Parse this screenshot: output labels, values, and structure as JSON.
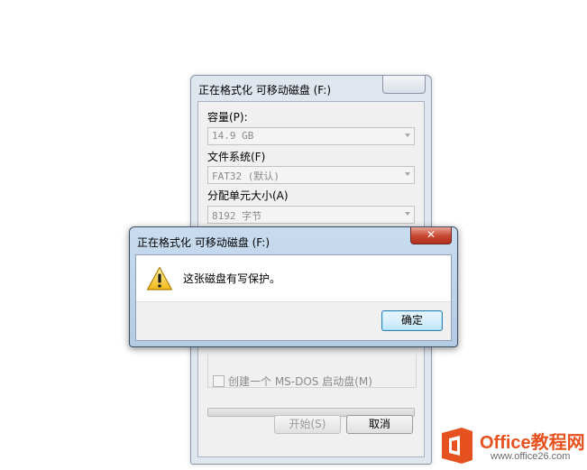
{
  "format_window": {
    "title": "正在格式化 可移动磁盘 (F:)",
    "capacity_label": "容量(P):",
    "capacity_value": "14.9 GB",
    "filesystem_label": "文件系统(F)",
    "filesystem_value": "FAT32 (默认)",
    "alloc_label": "分配单元大小(A)",
    "alloc_value": "8192 字节",
    "msdos_checkbox_label": "创建一个 MS-DOS 启动盘(M)",
    "msdos_checked": false,
    "progress": 0,
    "start_button": "开始(S)",
    "cancel_button": "取消"
  },
  "error_dialog": {
    "title": "正在格式化 可移动磁盘 (F:)",
    "close_glyph": "✕",
    "icon": "warning-icon",
    "message": "这张磁盘有写保护。",
    "ok_button": "确定"
  },
  "watermark": {
    "brand": "Office教程网",
    "url": "www.office26.com",
    "logo_color": "#e6521f"
  }
}
